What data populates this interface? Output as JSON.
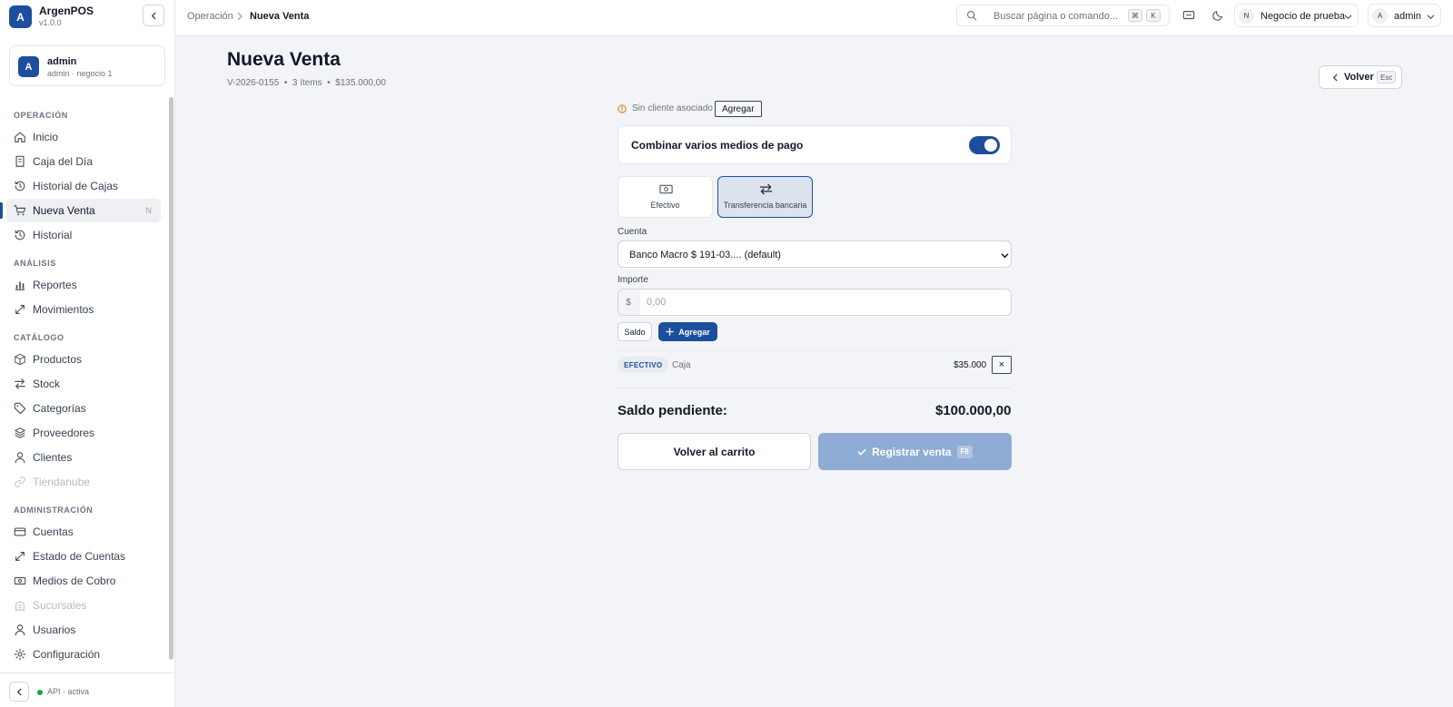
{
  "app": {
    "name": "ArgenPOS",
    "version": "v1.0.0",
    "logo_letter": "A"
  },
  "user": {
    "avatar_letter": "A",
    "name": "admin",
    "subtitle": "admin · negocio 1"
  },
  "nav": {
    "sections": {
      "operacion": "OPERACIÓN",
      "analisis": "ANÁLISIS",
      "catalogo": "CATÁLOGO",
      "administracion": "ADMINISTRACIÓN"
    },
    "items": {
      "inicio": "Inicio",
      "caja": "Caja del Día",
      "historial_cajas": "Historial de Cajas",
      "nueva_venta": "Nueva Venta",
      "nueva_venta_kbd": "N",
      "historial": "Historial",
      "reportes": "Reportes",
      "movimientos": "Movimientos",
      "productos": "Productos",
      "stock": "Stock",
      "categorias": "Categorías",
      "proveedores": "Proveedores",
      "clientes": "Clientes",
      "tiendanube": "Tiendanube",
      "cuentas": "Cuentas",
      "estado_cuentas": "Estado de Cuentas",
      "medios_cobro": "Medios de Cobro",
      "sucursales": "Sucursales",
      "usuarios": "Usuarios",
      "configuracion": "Configuración"
    }
  },
  "footer": {
    "api_status": "API · activa",
    "status_color": "#16a34a"
  },
  "topbar": {
    "breadcrumb_parent": "Operación",
    "breadcrumb_current": "Nueva Venta",
    "search_placeholder": "Buscar página o comando...",
    "search_kbd_1": "⌘",
    "search_kbd_2": "K",
    "business": {
      "avatar": "N",
      "label": "Negocio de prueba"
    },
    "account": {
      "avatar": "A",
      "label": "admin"
    }
  },
  "page": {
    "title": "Nueva Venta",
    "meta": "V-2026-0155  •  3 ítems  •  $135.000,00",
    "back_label": "Volver",
    "back_kbd": "Esc"
  },
  "sale": {
    "client_text": "Sin cliente asociado",
    "client_add": "Agregar",
    "combine_label": "Combinar varios medios de pago",
    "combine_enabled": true,
    "methods": [
      "Efectivo",
      "Transferencia bancaria"
    ],
    "selected_method": "Transferencia bancaria",
    "account_label": "Cuenta",
    "account_value": "Banco Macro $ 191-03.... (default)",
    "amount_label": "Importe",
    "amount_prefix": "$",
    "amount_placeholder": "0,00",
    "saldo_button": "Saldo",
    "add_button": "Agregar",
    "payments": [
      {
        "method": "EFECTIVO",
        "account": "Caja",
        "amount": "$35.000",
        "remove": "×"
      }
    ],
    "pending_label": "Saldo pendiente:",
    "pending_amount": "$100.000,00",
    "back_to_cart": "Volver al carrito",
    "register": "Registrar venta",
    "register_kbd": "F8"
  },
  "colors": {
    "accent": "#1d4e9e",
    "register_disabled": "#8facd4",
    "warning": "#d97706"
  }
}
